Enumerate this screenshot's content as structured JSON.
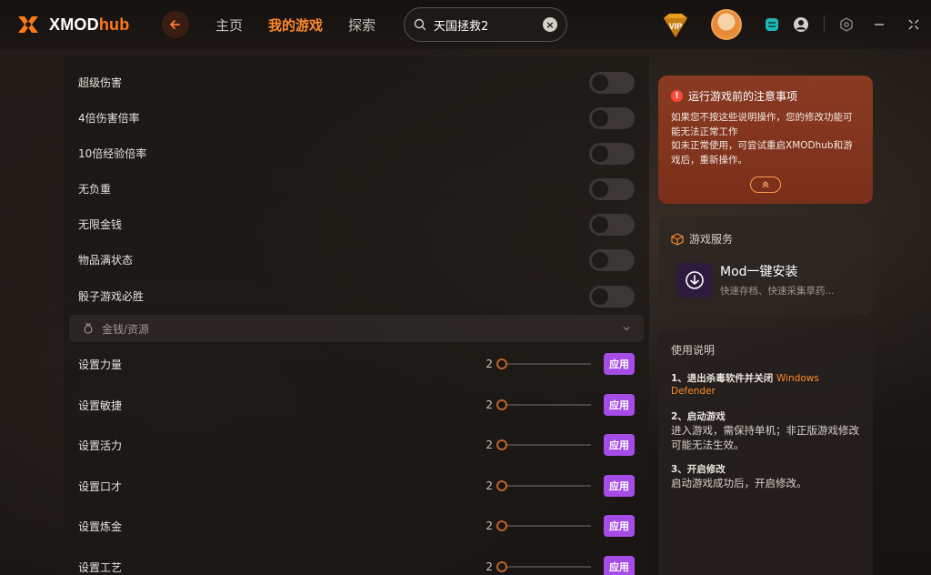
{
  "app": {
    "logo_main": "XMOD",
    "logo_accent": "hub"
  },
  "nav": {
    "items": [
      {
        "label": "主页",
        "active": false
      },
      {
        "label": "我的游戏",
        "active": true
      },
      {
        "label": "探索",
        "active": false
      }
    ]
  },
  "search": {
    "value": "天国拯救2",
    "clear_icon": "close-icon"
  },
  "colors": {
    "accent": "#ff8a2a",
    "apply_button": "#a54ce6",
    "notice_bg": "#8a3a22"
  },
  "toggles": [
    {
      "label": "超级伤害",
      "on": false
    },
    {
      "label": "4倍伤害倍率",
      "on": false
    },
    {
      "label": "10倍经验倍率",
      "on": false
    },
    {
      "label": "无负重",
      "on": false
    },
    {
      "label": "无限金钱",
      "on": false
    },
    {
      "label": "物品满状态",
      "on": false
    },
    {
      "label": "骰子游戏必胜",
      "on": false
    }
  ],
  "section": {
    "title": "金钱/资源",
    "icon": "coin-bag-icon",
    "expanded": true
  },
  "sliders": [
    {
      "label": "设置力量",
      "value": "2",
      "button": "应用"
    },
    {
      "label": "设置敏捷",
      "value": "2",
      "button": "应用"
    },
    {
      "label": "设置活力",
      "value": "2",
      "button": "应用"
    },
    {
      "label": "设置口才",
      "value": "2",
      "button": "应用"
    },
    {
      "label": "设置炼金",
      "value": "2",
      "button": "应用"
    },
    {
      "label": "设置工艺",
      "value": "2",
      "button": "应用"
    }
  ],
  "notice": {
    "title": "运行游戏前的注意事项",
    "line1": "如果您不按这些说明操作，您的修改功能可能无法正常工作",
    "line2": "如未正常使用，可尝试重启XMODhub和游戏后，重新操作。"
  },
  "services": {
    "title": "游戏服务",
    "item_name": "Mod一键安装",
    "item_desc": "快速存档、快速采集草药..."
  },
  "usage": {
    "title": "使用说明",
    "step1_title": "1、退出杀毒软件并关闭",
    "step1_highlight": "Windows Defender",
    "step2_title": "2、启动游戏",
    "step2_desc": "进入游戏，需保持单机；非正版游戏修改可能无法生效。",
    "step3_title": "3、开启修改",
    "step3_desc": "启动游戏成功后，开启修改。"
  }
}
